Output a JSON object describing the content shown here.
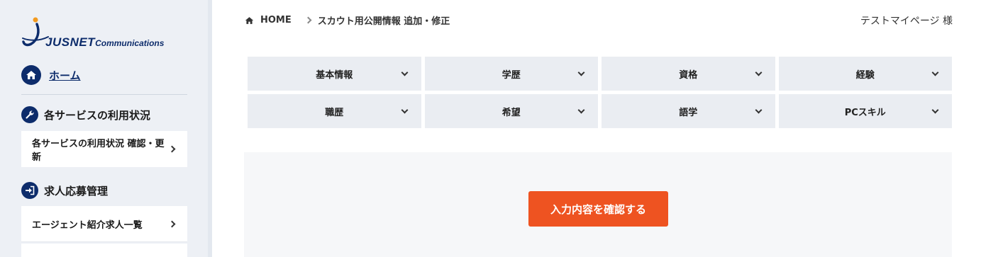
{
  "colors": {
    "brand_navy": "#0d2c6b",
    "accent_orange": "#ee5321",
    "sidebar_bg": "#edf0f5",
    "tab_bg": "#eaedf2"
  },
  "logo": {
    "brand_main": "JUSNET",
    "brand_sub": "Communications"
  },
  "sidebar": {
    "home": {
      "label": "ホーム",
      "icon": "home-icon"
    },
    "sections": [
      {
        "label": "各サービスの利用状況",
        "icon": "wrench-icon",
        "items": [
          {
            "label": "各サービスの利用状況 確認・更新"
          }
        ]
      },
      {
        "label": "求人応募管理",
        "icon": "sign-in-icon",
        "items": [
          {
            "label": "エージェント紹介求人一覧"
          }
        ]
      }
    ]
  },
  "header": {
    "breadcrumb": [
      {
        "label": "HOME",
        "icon": "home-icon"
      },
      {
        "label": "スカウト用公開情報 追加・修正"
      }
    ],
    "user_name": "テストマイページ 様"
  },
  "tabs": [
    {
      "label": "基本情報"
    },
    {
      "label": "学歴"
    },
    {
      "label": "資格"
    },
    {
      "label": "経験"
    },
    {
      "label": "職歴"
    },
    {
      "label": "希望"
    },
    {
      "label": "語学"
    },
    {
      "label": "PCスキル"
    }
  ],
  "confirm": {
    "button_label": "入力内容を確認する"
  }
}
